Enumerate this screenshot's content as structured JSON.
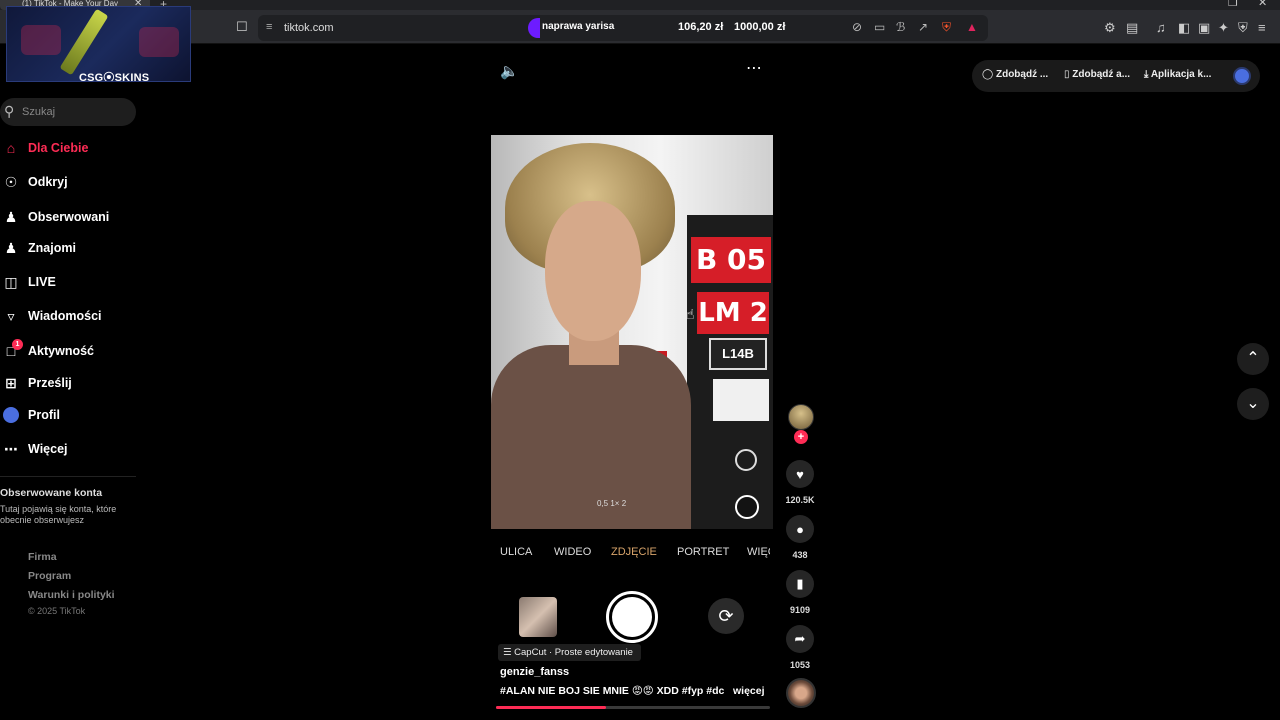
{
  "browser": {
    "tab_title": "(1) TikTok - Make Your Day",
    "tab_close": "✕",
    "new_tab": "+",
    "window_controls": {
      "restore": "❐",
      "close": "✕"
    },
    "url": "tiktok.com",
    "extension_label": "naprawa yarisa",
    "price_a": "106,20 zł",
    "price_b": "1000,00 zł"
  },
  "overlay": {
    "label": "CSG⦿SKINS"
  },
  "sidebar": {
    "search_placeholder": "Szukaj",
    "items": [
      {
        "label": "Dla Ciebie",
        "icon": "home-icon"
      },
      {
        "label": "Odkryj",
        "icon": "compass-icon"
      },
      {
        "label": "Obserwowani",
        "icon": "person-follow-icon"
      },
      {
        "label": "Znajomi",
        "icon": "friends-icon"
      },
      {
        "label": "LIVE",
        "icon": "live-icon"
      },
      {
        "label": "Wiadomości",
        "icon": "send-icon"
      },
      {
        "label": "Aktywność",
        "icon": "activity-icon",
        "badge": "1"
      },
      {
        "label": "Prześlij",
        "icon": "upload-icon"
      },
      {
        "label": "Profil",
        "icon": "profile-icon"
      },
      {
        "label": "Więcej",
        "icon": "more-icon"
      }
    ],
    "followed_title": "Obserwowane konta",
    "followed_desc": "Tutaj pojawią się konta, które obecnie obserwujesz",
    "footer_links": [
      "Firma",
      "Program",
      "Warunki i polityki"
    ],
    "copyright": "© 2025 TikTok"
  },
  "topbar": {
    "btn_coins": "Zdobądź ...",
    "btn_app": "Zdobądź a...",
    "btn_download": "Aplikacja k..."
  },
  "video": {
    "sign_top": "B 05",
    "sign_mid": "LM 2",
    "sign_small": "L14B",
    "camera_zoom": "0,5   1×   2",
    "modes": [
      "ULICA",
      "WIDEO",
      "ZDJĘCIE",
      "PORTRET",
      "WIĘCEJ"
    ],
    "active_mode": "ZDJĘCIE",
    "capcut": "CapCut · Proste edytowanie",
    "author": "genzie_fanss",
    "caption": "#ALAN NIE BOJ SIE MNIE 😡😡 XDD #fyp #dc ...",
    "more": "więcej",
    "progress": 0.4
  },
  "actions": {
    "likes": "120.5K",
    "comments": "438",
    "saves": "9109",
    "shares": "1053"
  },
  "colors": {
    "accent": "#fe2c55",
    "active_mode": "#d9a56b"
  }
}
